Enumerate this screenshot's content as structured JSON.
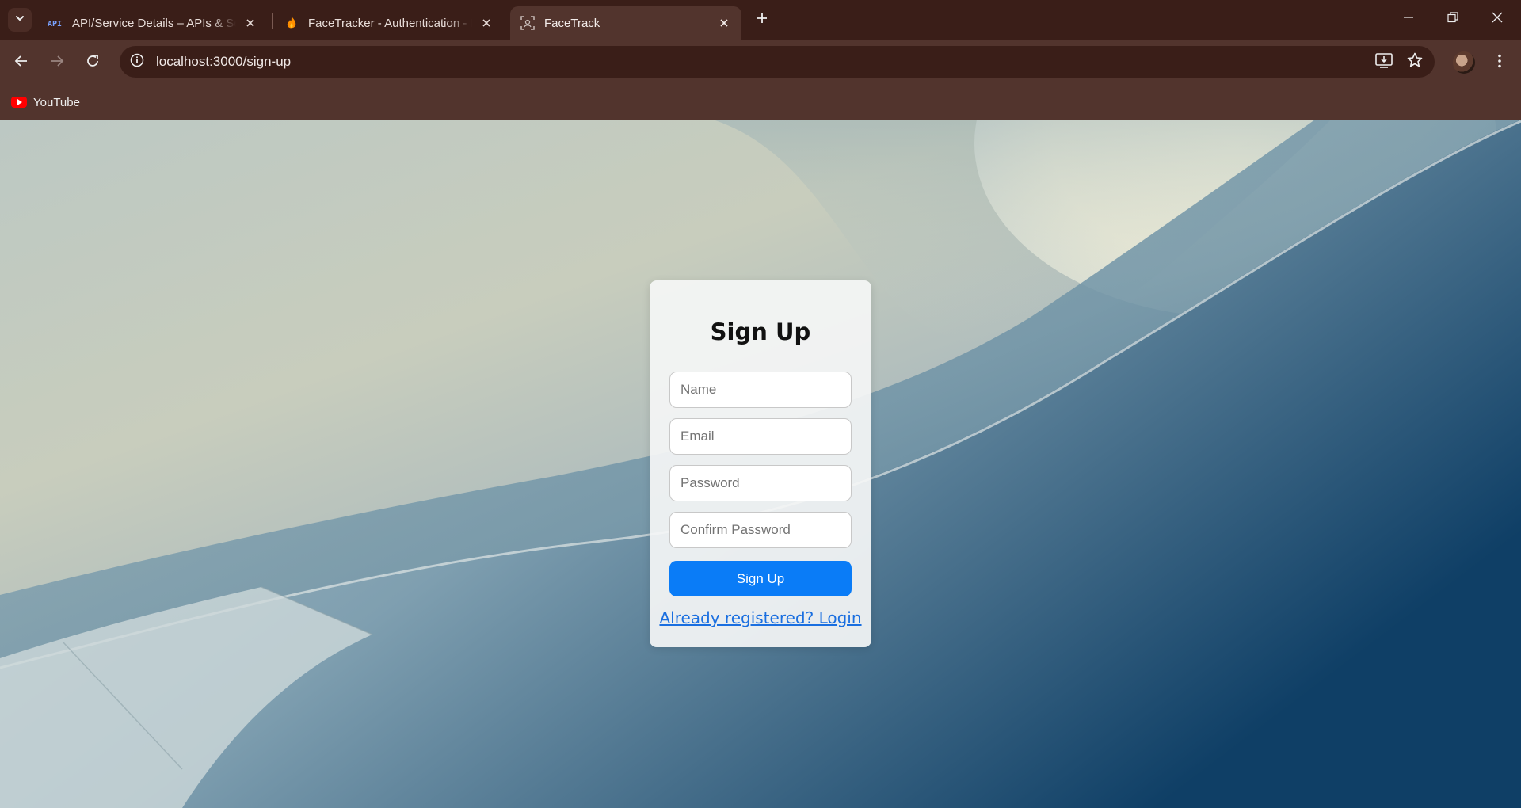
{
  "browser": {
    "tabs": [
      {
        "title": "API/Service Details – APIs & Services",
        "icon": "api-icon",
        "active": false
      },
      {
        "title": "FaceTracker - Authentication - Firebase",
        "icon": "firebase-icon",
        "active": false
      },
      {
        "title": "FaceTrack",
        "icon": "face-scan-icon",
        "active": true
      }
    ],
    "new_tab_icon": "plus-icon",
    "url": "localhost:3000/sign-up",
    "bookmarks": [
      {
        "label": "YouTube",
        "icon": "youtube-icon"
      }
    ]
  },
  "signup": {
    "title": "Sign Up",
    "fields": {
      "name_placeholder": "Name",
      "email_placeholder": "Email",
      "password_placeholder": "Password",
      "confirm_placeholder": "Confirm Password"
    },
    "submit_label": "Sign Up",
    "login_link": "Already registered? Login"
  },
  "colors": {
    "titlebar": "#3a1e18",
    "toolbar": "#52342d",
    "primary_button": "#0a7cf7",
    "link": "#1a6fe0"
  }
}
